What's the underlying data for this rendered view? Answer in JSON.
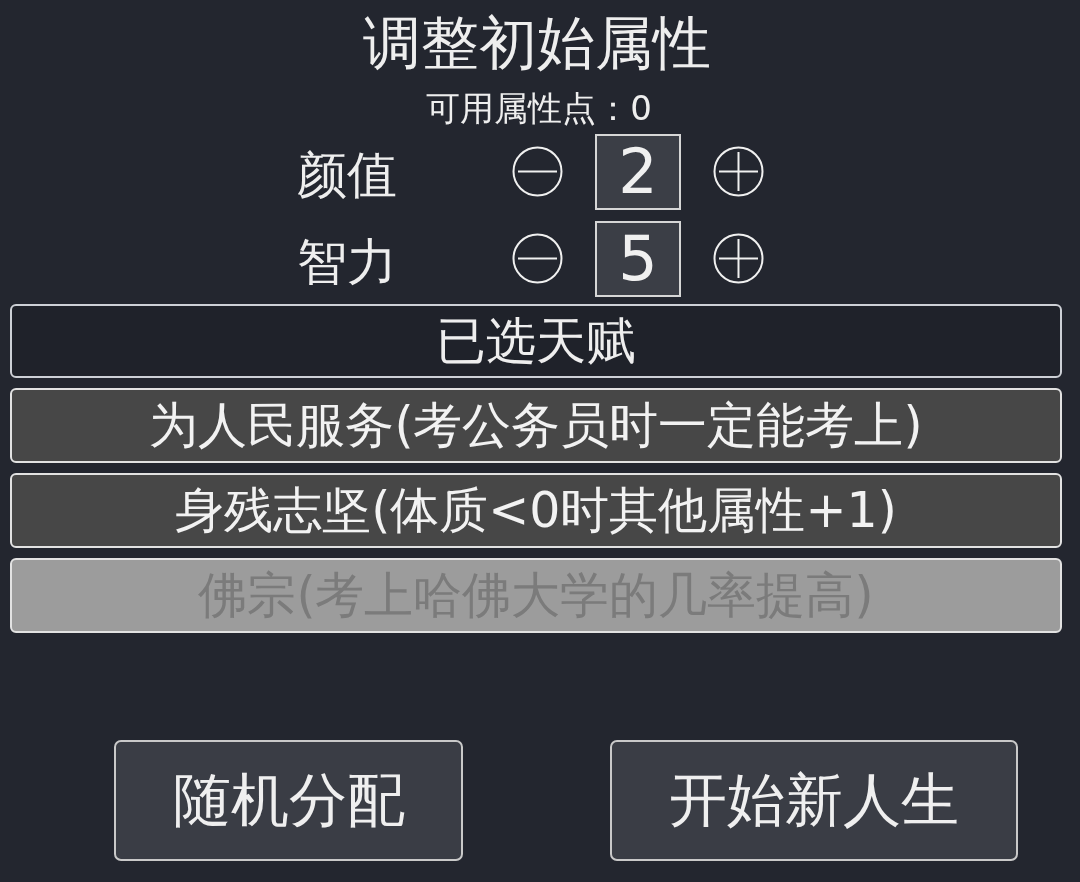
{
  "title": "调整初始属性",
  "points": "可用属性点：0",
  "attributes": [
    {
      "label": "颜值",
      "value": "2"
    },
    {
      "label": "智力",
      "value": "5"
    }
  ],
  "talents": {
    "header": "已选天赋",
    "items": [
      {
        "label": "为人民服务(考公务员时一定能考上)",
        "disabled": false
      },
      {
        "label": "身残志坚(体质<0时其他属性+1)",
        "disabled": false
      },
      {
        "label": "佛宗(考上哈佛大学的几率提高)",
        "disabled": true
      }
    ]
  },
  "buttons": [
    {
      "label": "随机分配"
    },
    {
      "label": "开始新人生"
    }
  ]
}
